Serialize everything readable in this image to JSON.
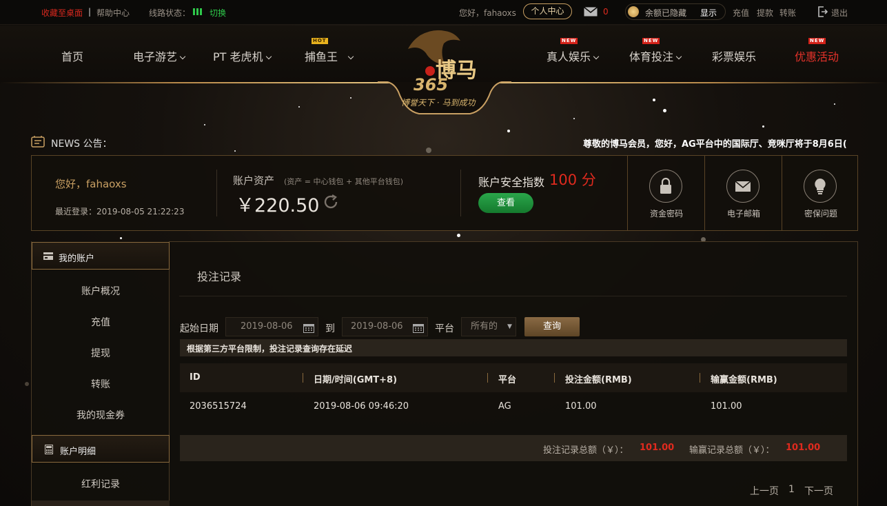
{
  "topbar": {
    "bookmark": "收藏至桌面",
    "help": "帮助中心",
    "line_status_label": "线路状态：",
    "switch_label": "切换",
    "greeting": "您好，fahaoxs",
    "user_center": "个人中心",
    "mail_count": "0",
    "balance_hidden": "余额已隐藏",
    "show_label": "显示",
    "deposit": "充值",
    "withdraw": "提款",
    "transfer": "转账",
    "logout": "退出"
  },
  "nav": {
    "items": [
      {
        "label": "首页"
      },
      {
        "label": "电子游艺"
      },
      {
        "label": "PT 老虎机"
      },
      {
        "label": "捕鱼王",
        "badge": "HOT"
      },
      {
        "label": "真人娱乐",
        "badge": "NEW"
      },
      {
        "label": "体育投注",
        "badge": "NEW"
      },
      {
        "label": "彩票娱乐"
      },
      {
        "label": "优惠活动",
        "badge": "NEW"
      }
    ],
    "logo_text": "博马",
    "logo_number": "365",
    "logo_slogan": "博誉天下 · 马到成功"
  },
  "news": {
    "label": "NEWS 公告：",
    "text": "尊敬的博马会员，您好，AG平台中的国际厅、竞咪厅将于8月6日("
  },
  "account": {
    "greeting": "您好，fahaoxs",
    "last_login": "最近登录：2019-08-05 21:22:23",
    "assets_label": "账户资产",
    "assets_note": "(资产 = 中心钱包 + 其他平台钱包)",
    "balance": "￥220.50",
    "security_label": "账户安全指数",
    "security_score": "100 分",
    "view_button": "查看",
    "security_items": [
      {
        "label": "资金密码",
        "icon": "lock-icon"
      },
      {
        "label": "电子邮箱",
        "icon": "mail-icon"
      },
      {
        "label": "密保问题",
        "icon": "lightbulb-icon"
      }
    ]
  },
  "sidebar": {
    "section1": "我的账户",
    "items1": [
      "账户概况",
      "充值",
      "提现",
      "转账",
      "我的现金券"
    ],
    "section2": "账户明细",
    "items2": [
      "红利记录"
    ]
  },
  "main": {
    "title": "投注记录",
    "start_date_label": "起始日期",
    "start_date": "2019-08-06",
    "to_label": "到",
    "end_date": "2019-08-06",
    "platform_label": "平台",
    "platform_value": "所有的",
    "query_button": "查询",
    "notice": "根据第三方平台限制，投注记录查询存在延迟",
    "columns": [
      "ID",
      "日期/时间(GMT+8)",
      "平台",
      "投注金额(RMB)",
      "输赢金额(RMB)"
    ],
    "rows": [
      [
        "2036515724",
        "2019-08-06 09:46:20",
        "AG",
        "101.00",
        "101.00"
      ]
    ],
    "total_bet_label": "投注记录总额（￥）：",
    "total_bet": "101.00",
    "total_win_label": "输赢记录总额（￥）：",
    "total_win": "101.00",
    "prev_page": "上一页",
    "page": "1",
    "next_page": "下一页"
  },
  "colors": {
    "gold": "#c9a063",
    "red": "#e02a1e",
    "green": "#1f8f3a"
  }
}
